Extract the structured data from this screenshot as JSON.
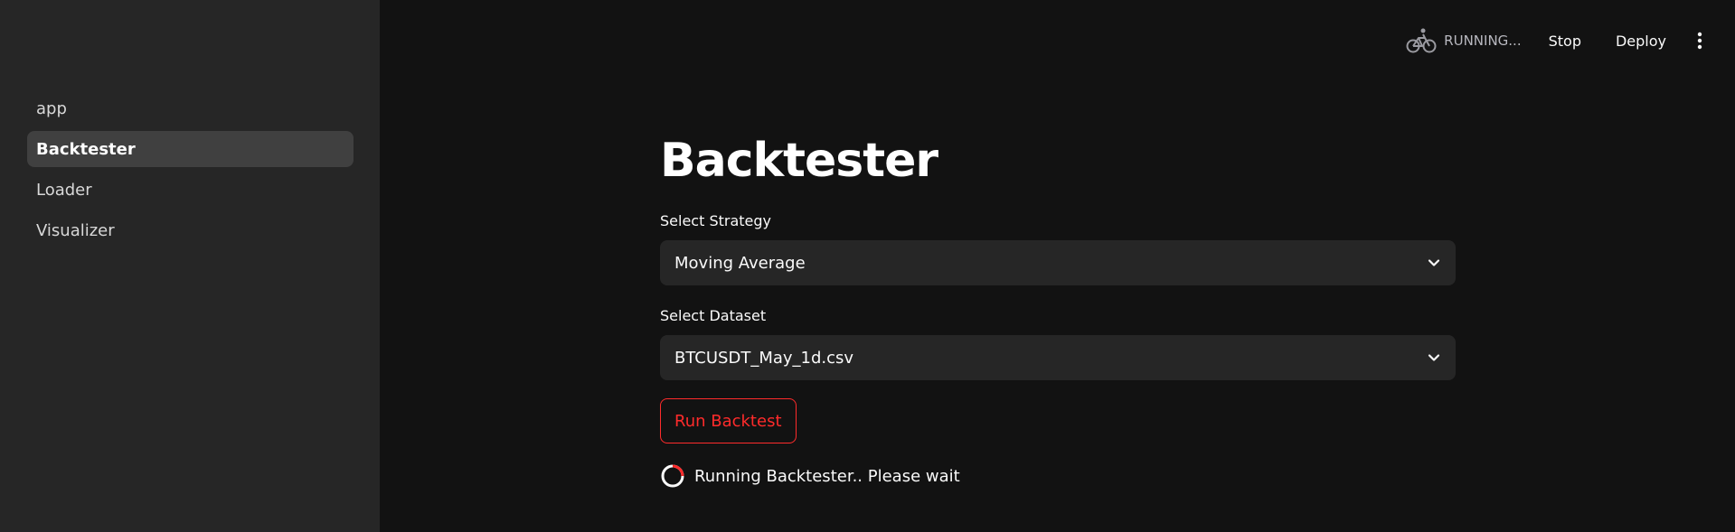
{
  "sidebar": {
    "items": [
      {
        "label": "app",
        "active": false
      },
      {
        "label": "Backtester",
        "active": true
      },
      {
        "label": "Loader",
        "active": false
      },
      {
        "label": "Visualizer",
        "active": false
      }
    ]
  },
  "toolbar": {
    "status_icon": "bicycle-icon",
    "status_text": "RUNNING...",
    "stop_label": "Stop",
    "deploy_label": "Deploy",
    "menu_icon": "kebab-menu-icon"
  },
  "main": {
    "title": "Backtester",
    "strategy": {
      "label": "Select Strategy",
      "value": "Moving Average"
    },
    "dataset": {
      "label": "Select Dataset",
      "value": "BTCUSDT_May_1d.csv"
    },
    "run_button_label": "Run Backtest",
    "spinner_text": "Running Backtester.. Please wait"
  },
  "colors": {
    "accent": "#ff2b2b",
    "background": "#121212",
    "sidebar": "#262626",
    "active_item": "#404040"
  }
}
